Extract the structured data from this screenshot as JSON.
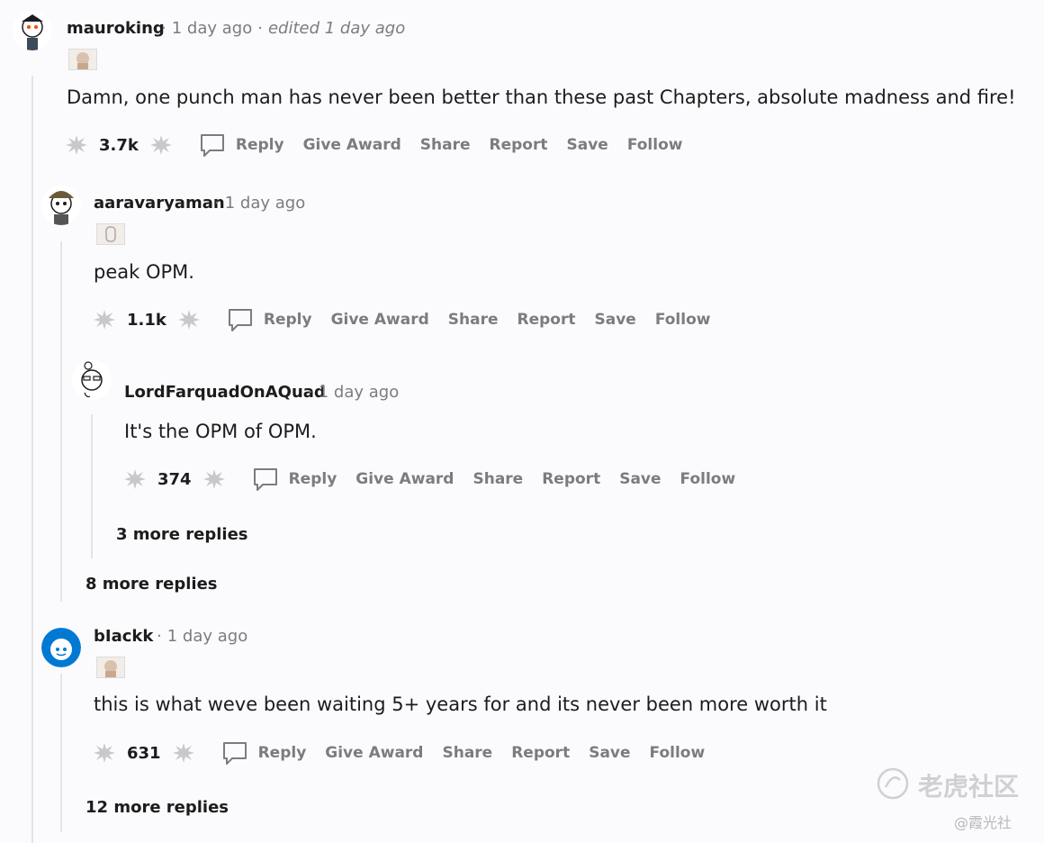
{
  "comments": [
    {
      "username": "mauroking",
      "time": "1 day ago",
      "edited": "edited 1 day ago",
      "body": "Damn, one punch man has never been better than these past Chapters, absolute madness and fire!",
      "score": "3.7k"
    },
    {
      "username": "aaravaryaman",
      "time": "1 day ago",
      "body": "peak OPM.",
      "score": "1.1k"
    },
    {
      "username": "LordFarquadOnAQuad",
      "time": "1 day ago",
      "body": "It's the OPM of OPM.",
      "score": "374"
    },
    {
      "username": "bIackk",
      "time": "1 day ago",
      "body": "this is what weve been waiting 5+ years for and its never been more worth it",
      "score": "631"
    }
  ],
  "actions": {
    "reply": "Reply",
    "give_award": "Give Award",
    "share": "Share",
    "report": "Report",
    "save": "Save",
    "follow": "Follow"
  },
  "more_replies": {
    "lord": "3 more replies",
    "aarav": "8 more replies",
    "blackk": "12 more replies"
  },
  "watermark": {
    "main": "老虎社区",
    "sub": "@霞光社"
  },
  "icons": {
    "vote": "award-burst-icon",
    "reply": "speech-bubble-icon",
    "watermark": "tiger-logo-icon"
  }
}
